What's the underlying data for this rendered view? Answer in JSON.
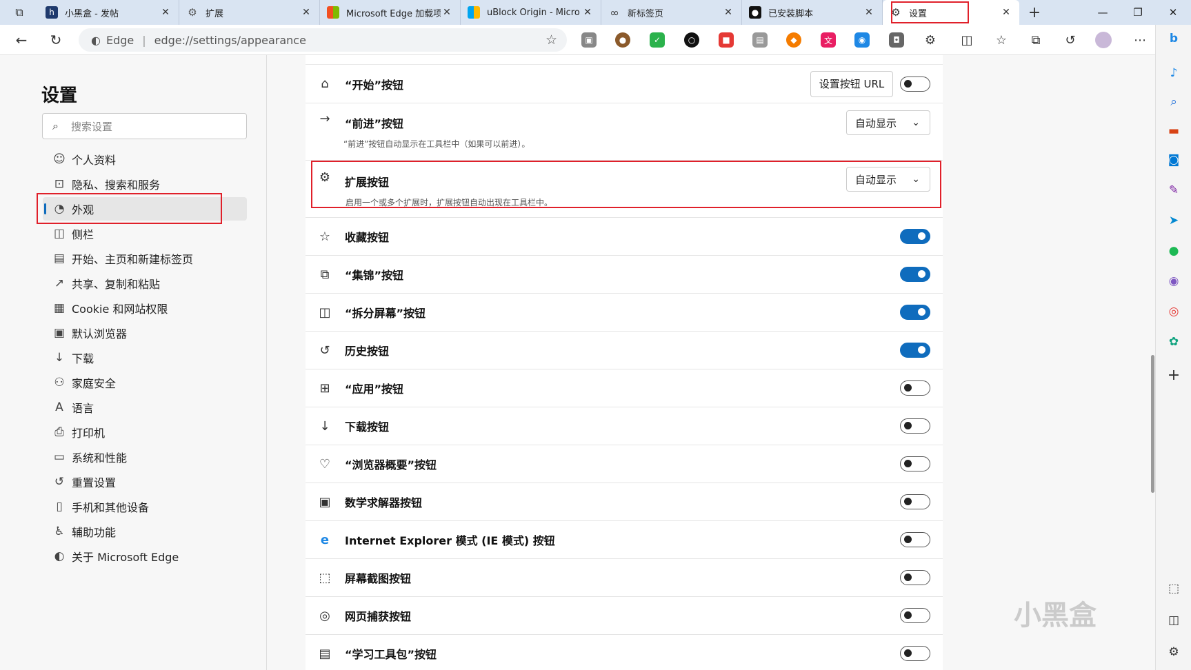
{
  "tabs": [
    {
      "title": "小黑盒 - 发帖",
      "icon": "heybox-icon",
      "color": "#1f3a6d"
    },
    {
      "title": "扩展",
      "icon": "extension-icon",
      "color": "#555555"
    },
    {
      "title": "Microsoft Edge 加载项",
      "icon": "microsoft-logo-icon",
      "color": "#f25022"
    },
    {
      "title": "uBlock Origin - Micro",
      "icon": "microsoft-logo-icon",
      "color": "#f25022"
    },
    {
      "title": "新标签页",
      "icon": "infinity-icon",
      "color": "#333333"
    },
    {
      "title": "已安装脚本",
      "icon": "tampermonkey-icon",
      "color": "#111111"
    },
    {
      "title": "设置",
      "icon": "gear-icon",
      "color": "#333333"
    }
  ],
  "address": {
    "site": "Edge",
    "url": "edge://settings/appearance"
  },
  "sidebar": {
    "title": "设置",
    "search_placeholder": "搜索设置",
    "items": [
      {
        "label": "个人资料",
        "icon": "profile-icon"
      },
      {
        "label": "隐私、搜索和服务",
        "icon": "lock-icon"
      },
      {
        "label": "外观",
        "icon": "palette-icon"
      },
      {
        "label": "侧栏",
        "icon": "sidebar-icon"
      },
      {
        "label": "开始、主页和新建标签页",
        "icon": "home-icon"
      },
      {
        "label": "共享、复制和粘贴",
        "icon": "share-icon"
      },
      {
        "label": "Cookie 和网站权限",
        "icon": "cookie-icon"
      },
      {
        "label": "默认浏览器",
        "icon": "browser-icon"
      },
      {
        "label": "下载",
        "icon": "download-icon"
      },
      {
        "label": "家庭安全",
        "icon": "family-icon"
      },
      {
        "label": "语言",
        "icon": "language-icon"
      },
      {
        "label": "打印机",
        "icon": "printer-icon"
      },
      {
        "label": "系统和性能",
        "icon": "laptop-icon"
      },
      {
        "label": "重置设置",
        "icon": "reset-icon"
      },
      {
        "label": "手机和其他设备",
        "icon": "phone-icon"
      },
      {
        "label": "辅助功能",
        "icon": "accessibility-icon"
      },
      {
        "label": "关于 Microsoft Edge",
        "icon": "edge-icon"
      }
    ]
  },
  "settings": {
    "home": {
      "label": "“开始”按钮",
      "button": "设置按钮 URL",
      "on": false
    },
    "forward": {
      "label": "“前进”按钮",
      "desc": "“前进”按钮自动显示在工具栏中（如果可以前进）。",
      "dropdown": "自动显示"
    },
    "extensions": {
      "label": "扩展按钮",
      "desc": "启用一个或多个扩展时，扩展按钮自动出现在工具栏中。",
      "dropdown": "自动显示"
    },
    "toggles": [
      {
        "label": "收藏按钮",
        "icon": "favorites-icon",
        "on": true
      },
      {
        "label": "“集锦”按钮",
        "icon": "collections-icon",
        "on": true
      },
      {
        "label": "“拆分屏幕”按钮",
        "icon": "split-screen-icon",
        "on": true
      },
      {
        "label": "历史按钮",
        "icon": "history-icon",
        "on": true
      },
      {
        "label": "“应用”按钮",
        "icon": "apps-icon",
        "on": false
      },
      {
        "label": "下载按钮",
        "icon": "download-icon",
        "on": false
      },
      {
        "label": "“浏览器概要”按钮",
        "icon": "heartbeat-icon",
        "on": false
      },
      {
        "label": "数学求解器按钮",
        "icon": "math-solver-icon",
        "on": false
      },
      {
        "label": "Internet Explorer 模式 (IE 模式) 按钮",
        "icon": "ie-icon",
        "on": false
      },
      {
        "label": "屏幕截图按钮",
        "icon": "screenshot-icon",
        "on": false
      },
      {
        "label": "网页捕获按钮",
        "icon": "web-capture-icon",
        "on": false
      },
      {
        "label": "“学习工具包”按钮",
        "icon": "learning-toolkit-icon",
        "on": false
      }
    ]
  },
  "watermark": "小黑盒"
}
